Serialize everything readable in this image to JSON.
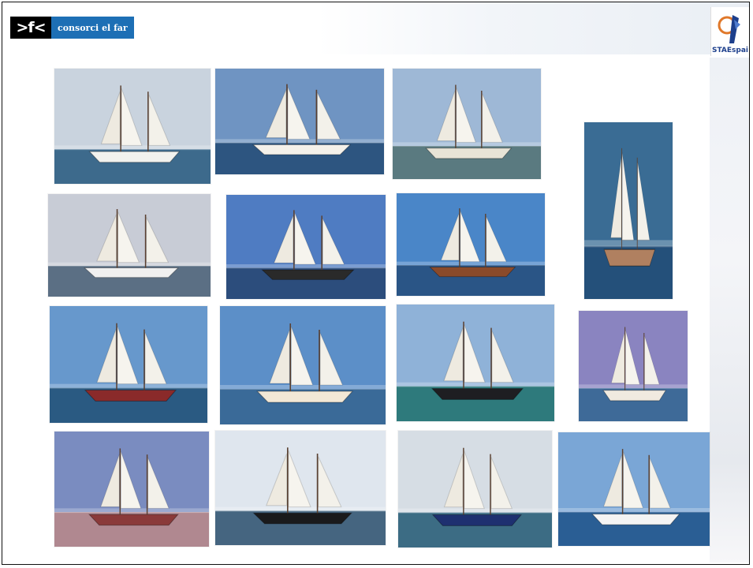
{
  "header": {
    "left_logo_mark": ">f<",
    "left_logo_text": "consorci el far",
    "right_logo_label": "STAEspai"
  },
  "photos": [
    {
      "name": "schooner-flag-photo",
      "sky": "#c9d3de",
      "sea": "#3d6a8c",
      "hull": "#f2f2ee"
    },
    {
      "name": "schooner-blue-sky-photo",
      "sky": "#6f94c2",
      "sea": "#2d5580",
      "hull": "#f4f1ea"
    },
    {
      "name": "harbor-masts-photo",
      "sky": "#9eb8d6",
      "sea": "#5a7a80",
      "hull": "#e8e4d6"
    },
    {
      "name": "tall-sail-aerial-photo",
      "sky": "#3a6c94",
      "sea": "#24507a",
      "hull": "#b08060"
    },
    {
      "name": "white-sail-coast-photo",
      "sky": "#c8ccd6",
      "sea": "#5b6f84",
      "hull": "#f0f0f0"
    },
    {
      "name": "schooner-dark-hull-photo",
      "sky": "#4f7cc2",
      "sea": "#2c4d7c",
      "hull": "#2a2a2a"
    },
    {
      "name": "wooden-schooner-photo",
      "sky": "#4a86c8",
      "sea": "#2a5586",
      "hull": "#8a4a2a"
    },
    {
      "name": "spinnaker-sail-photo",
      "sky": "#6798cc",
      "sea": "#2a5a82",
      "hull": "#8a2a2a"
    },
    {
      "name": "ketch-cream-hull-photo",
      "sky": "#5c8fc8",
      "sea": "#3a6a98",
      "hull": "#f2e8d6"
    },
    {
      "name": "black-hull-dock-photo",
      "sky": "#8fb2d8",
      "sea": "#2e7a7c",
      "hull": "#1e1e22"
    },
    {
      "name": "purple-sky-schooner-photo",
      "sky": "#8a84c0",
      "sea": "#3e6a98",
      "hull": "#f0eae0"
    },
    {
      "name": "sunset-schooner-photo",
      "sky": "#7a8cc0",
      "sea": "#b08890",
      "hull": "#8a3a3a"
    },
    {
      "name": "racing-yacht-photo",
      "sky": "#dfe6ee",
      "sea": "#456580",
      "hull": "#1a1a1c"
    },
    {
      "name": "moored-boat-pier-photo",
      "sky": "#d6dde4",
      "sea": "#3c6c84",
      "hull": "#1e3070"
    },
    {
      "name": "white-ketch-sea-photo",
      "sky": "#7aa6d6",
      "sea": "#2a5e94",
      "hull": "#f4f4f4"
    }
  ]
}
